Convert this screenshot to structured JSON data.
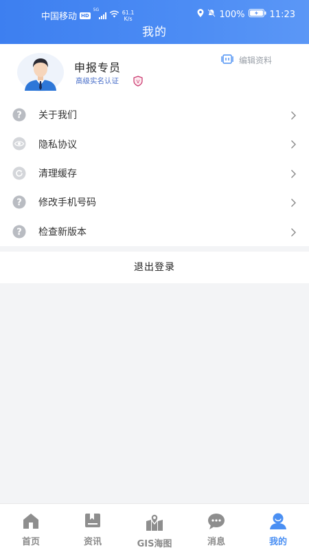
{
  "status_bar": {
    "carrier": "中国移动",
    "hd": "HD",
    "network": "5G",
    "speed_value": "61.1",
    "speed_unit": "K/s",
    "battery": "100%",
    "time": "11:23"
  },
  "header": {
    "title": "我的"
  },
  "profile": {
    "name": "申报专员",
    "certification": "高级实名认证",
    "badge_letter": "V",
    "edit_label": "编辑资料"
  },
  "menu": [
    {
      "label": "关于我们",
      "icon": "question-icon"
    },
    {
      "label": "隐私协议",
      "icon": "eye-icon"
    },
    {
      "label": "清理缓存",
      "icon": "refresh-icon"
    },
    {
      "label": "修改手机号码",
      "icon": "question-icon"
    },
    {
      "label": "检查新版本",
      "icon": "question-icon"
    }
  ],
  "logout_label": "退出登录",
  "tabs": [
    {
      "label": "首页",
      "icon": "home-icon",
      "active": false
    },
    {
      "label": "资讯",
      "icon": "news-icon",
      "active": false
    },
    {
      "label": "GIS海图",
      "icon": "map-icon",
      "active": false
    },
    {
      "label": "消息",
      "icon": "chat-icon",
      "active": false
    },
    {
      "label": "我的",
      "icon": "user-icon",
      "active": true
    }
  ],
  "colors": {
    "primary": "#4a8ff3",
    "header": "#3d7ff0",
    "inactive": "#8a8a8a"
  }
}
